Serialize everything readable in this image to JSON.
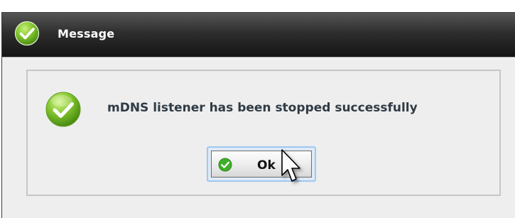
{
  "window": {
    "title": "Message"
  },
  "message": {
    "text": "mDNS listener has been stopped successfully"
  },
  "buttons": {
    "ok_label": "Ok"
  },
  "icons": {
    "title_icon": "check-circle-icon",
    "message_icon": "check-circle-icon",
    "ok_icon": "check-circle-icon",
    "cursor": "mouse-pointer-icon"
  },
  "colors": {
    "titlebar": "#1e1e1e",
    "success_green": "#6cc027",
    "focus_ring": "#9ec8f2",
    "message_text": "#2f3b45"
  }
}
